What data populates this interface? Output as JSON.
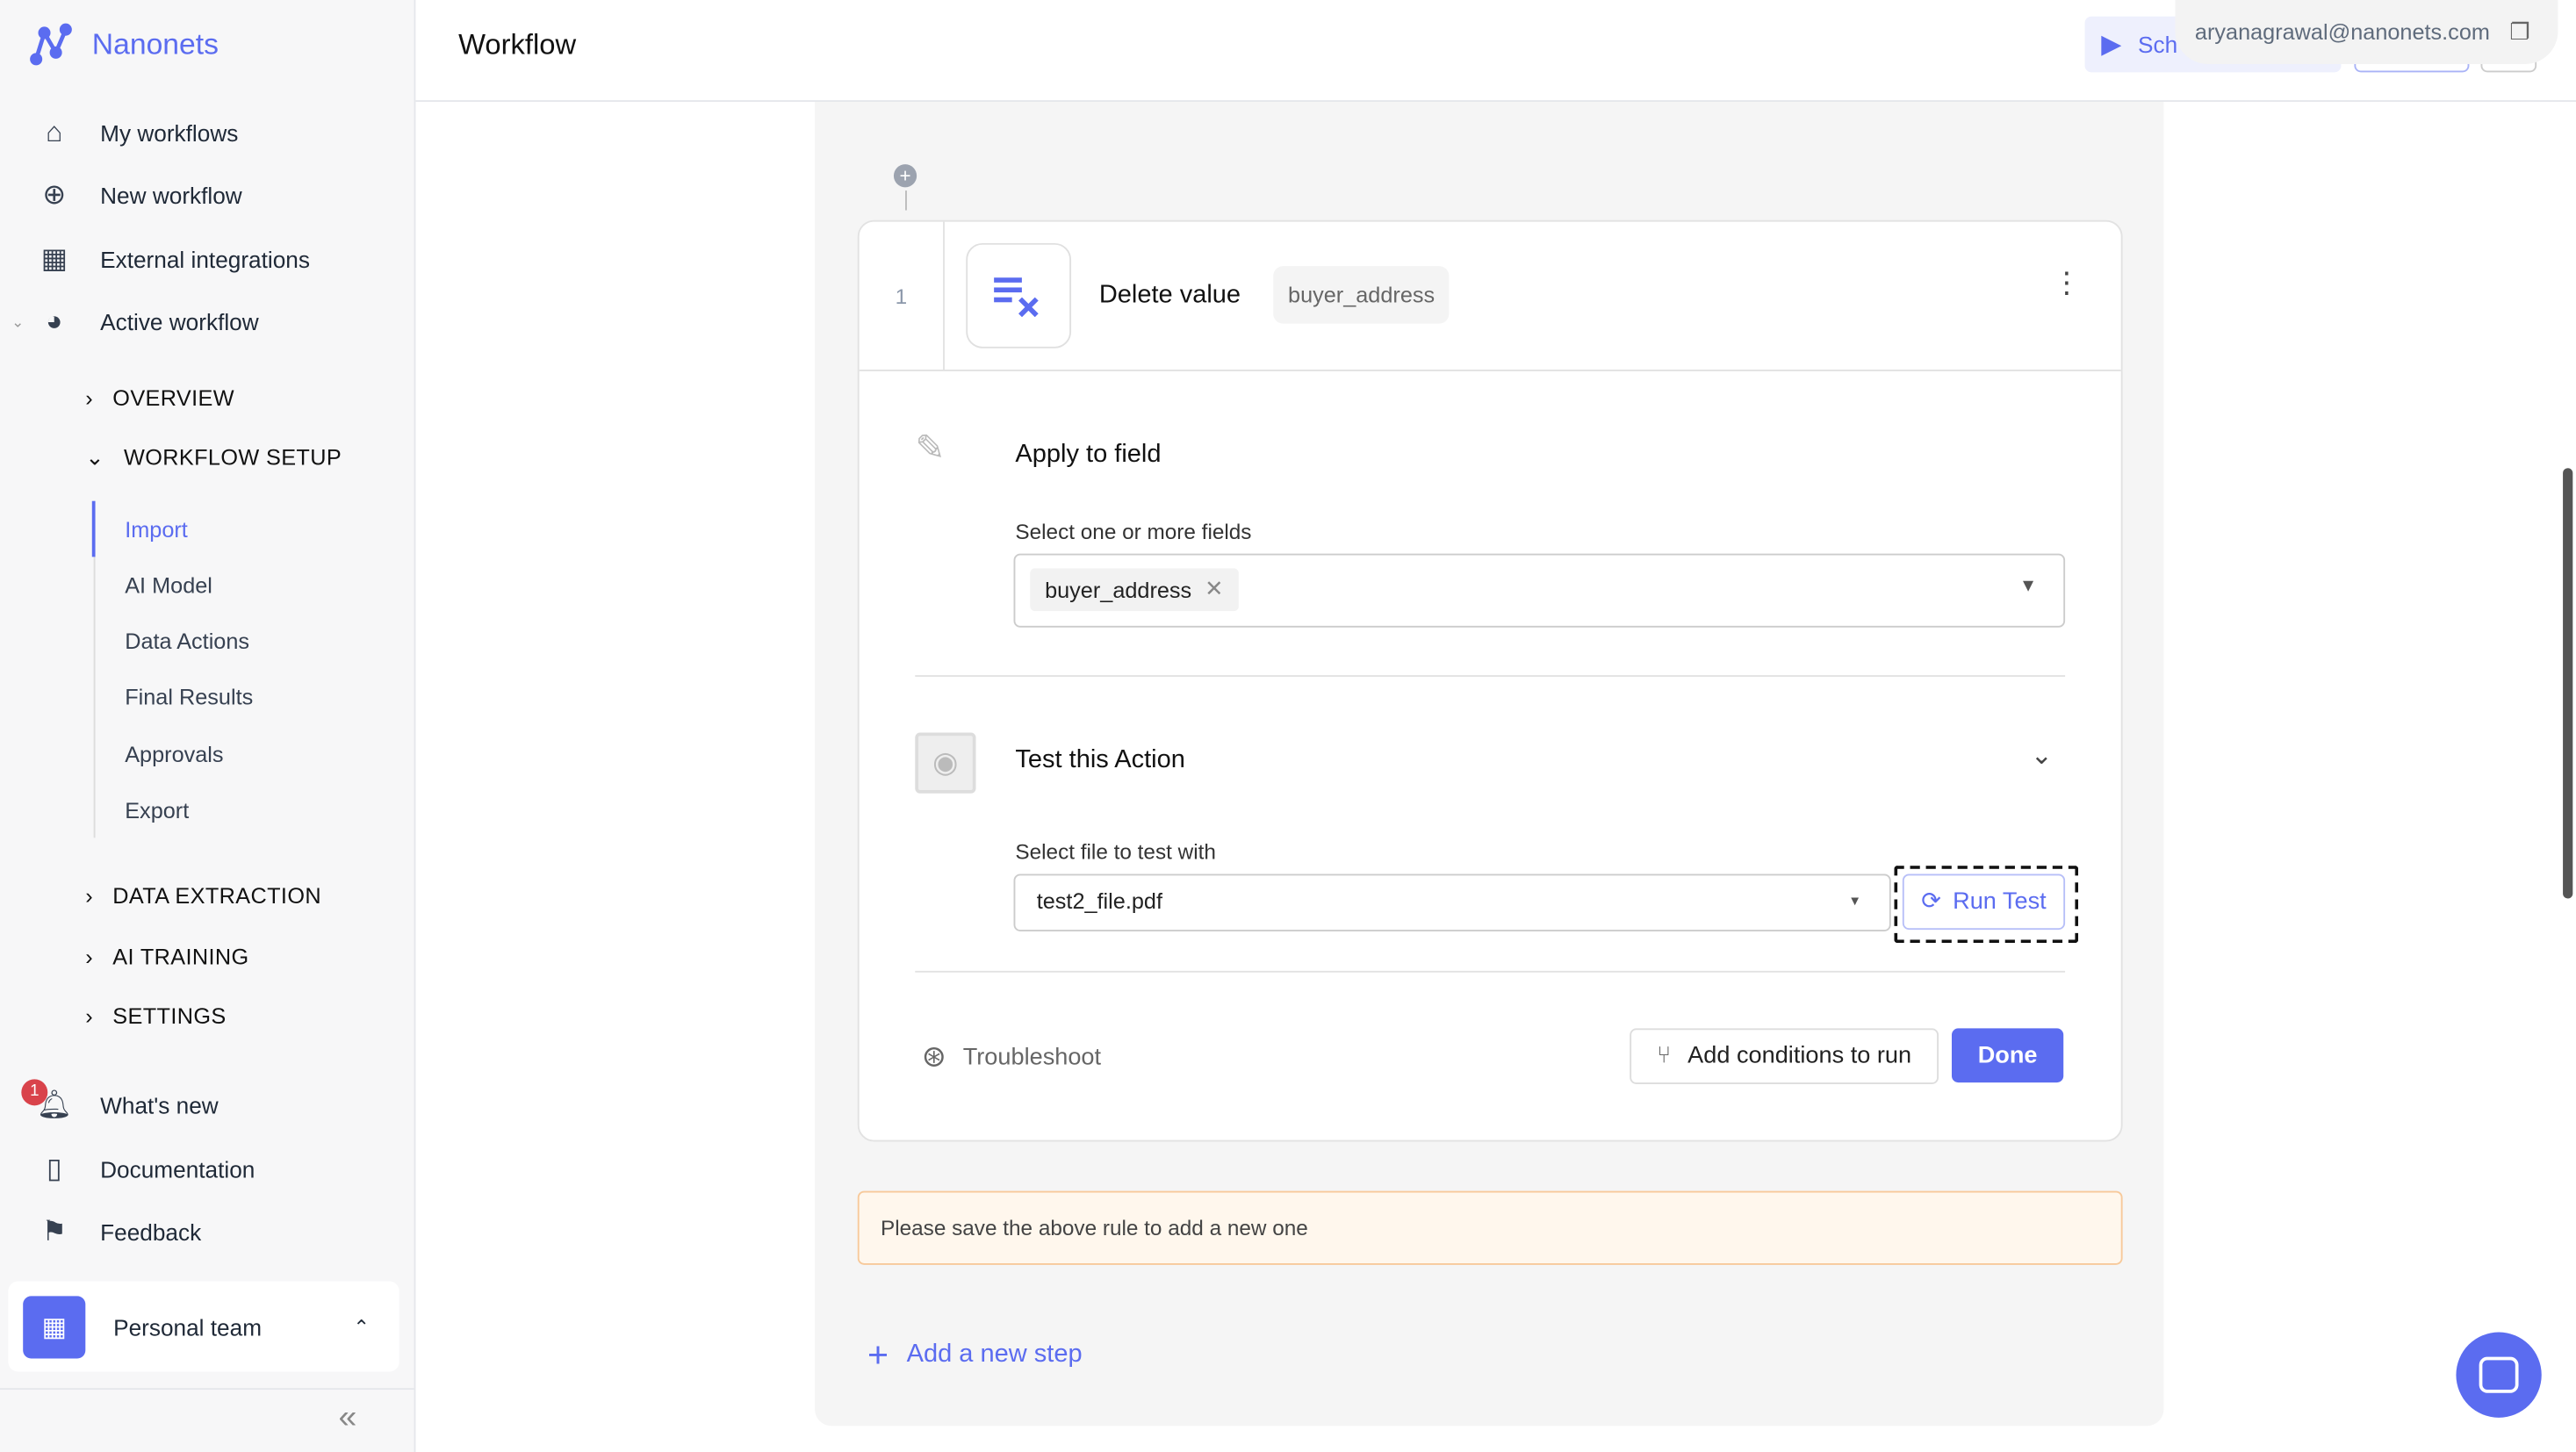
{
  "brand": "Nanonets",
  "sidebar": {
    "items": [
      {
        "label": "My workflows",
        "icon": "home-icon"
      },
      {
        "label": "New workflow",
        "icon": "plus-circle-icon"
      },
      {
        "label": "External integrations",
        "icon": "grid-icon"
      },
      {
        "label": "Active workflow",
        "icon": "compass-icon"
      }
    ],
    "sections": {
      "overview": "OVERVIEW",
      "setup": "WORKFLOW SETUP",
      "extraction": "DATA EXTRACTION",
      "training": "AI TRAINING",
      "settings": "SETTINGS"
    },
    "setup_items": [
      "Import",
      "AI Model",
      "Data Actions",
      "Final Results",
      "Approvals",
      "Export"
    ],
    "active_setup": "Import",
    "bottom": [
      {
        "label": "What's new",
        "icon": "bell-icon",
        "badge": "1"
      },
      {
        "label": "Documentation",
        "icon": "book-icon"
      },
      {
        "label": "Feedback",
        "icon": "feedback-icon"
      }
    ],
    "team": "Personal team"
  },
  "header": {
    "title": "Workflow",
    "schedule_label": "Sch",
    "email": "aryanagrawal@nanonets.com"
  },
  "step": {
    "number": "1",
    "title": "Delete value",
    "tag": "buyer_address",
    "apply": {
      "title": "Apply to field",
      "label": "Select one or more fields",
      "chip": "buyer_address"
    },
    "test": {
      "title": "Test this Action",
      "label": "Select file to test with",
      "file": "test2_file.pdf",
      "run": "Run Test"
    },
    "troubleshoot": "Troubleshoot",
    "conditions": "Add conditions to run",
    "done": "Done"
  },
  "notice": "Please save the above rule to add a new one",
  "add_step": "Add a new step",
  "colors": {
    "accent": "#5b6cf0",
    "notice_bg": "#fff7ed",
    "notice_border": "#f7c99a"
  }
}
